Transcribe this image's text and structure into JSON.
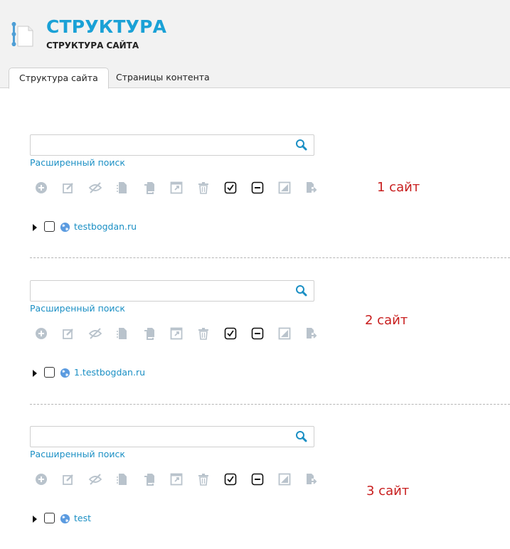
{
  "header": {
    "title": "СТРУКТУРА",
    "subtitle": "СТРУКТУРА САЙТА"
  },
  "tabs": [
    {
      "label": "Структура сайта",
      "active": true
    },
    {
      "label": "Страницы контента",
      "active": false
    }
  ],
  "colors": {
    "accent": "#1aa1d6",
    "link": "#1a8fc4",
    "annotation": "#c81e1e",
    "icon_disabled": "#b9c3cc"
  },
  "toolbar_icons": [
    "add-icon",
    "edit-icon",
    "hide-icon",
    "copy-icon",
    "duplicate-icon",
    "open-external-icon",
    "delete-icon",
    "select-all-icon",
    "deselect-all-icon",
    "template-icon",
    "export-icon"
  ],
  "blocks": [
    {
      "search_placeholder": "",
      "advanced_search": "Расширенный поиск",
      "site_label": "1 сайт",
      "tree_item": "testbogdan.ru"
    },
    {
      "search_placeholder": "",
      "advanced_search": "Расширенный поиск",
      "site_label": "2 сайт",
      "tree_item": "1.testbogdan.ru"
    },
    {
      "search_placeholder": "",
      "advanced_search": "Расширенный поиск",
      "site_label": "3 сайт",
      "tree_item": "test"
    }
  ]
}
